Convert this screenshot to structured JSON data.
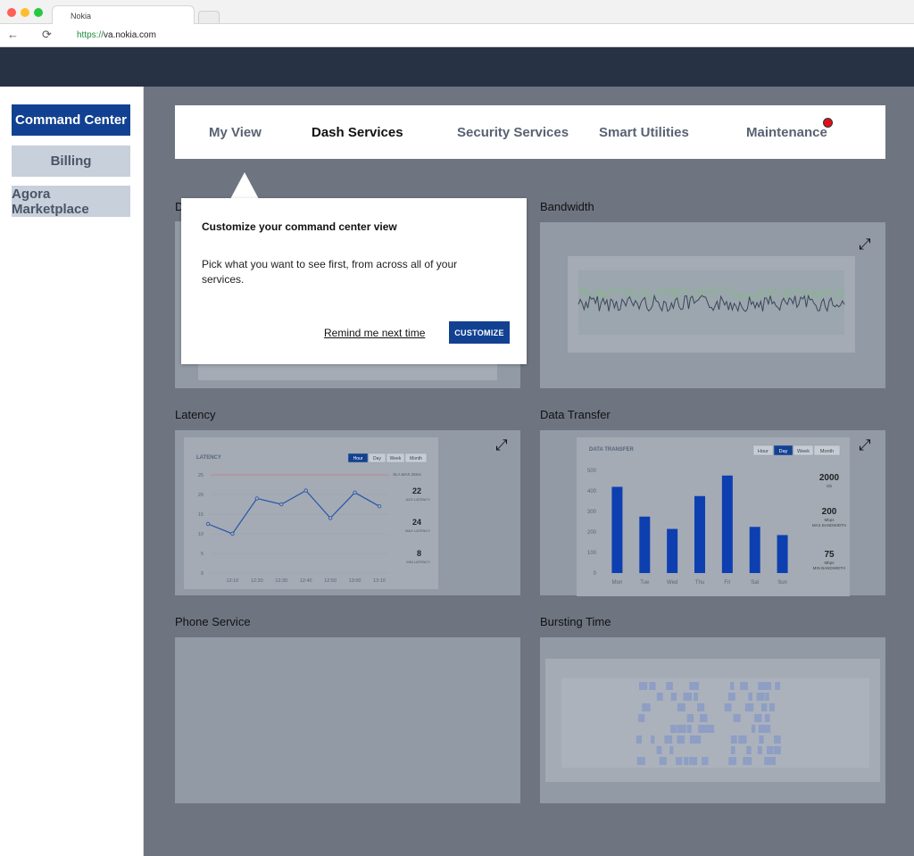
{
  "browser": {
    "tab_title": "Nokia",
    "url_protocol": "https://",
    "url_host": "va.nokia.com",
    "dot_colors": [
      "#fe5f57",
      "#febc2e",
      "#28c840"
    ]
  },
  "sidebar": {
    "items": [
      {
        "label": "Command Center",
        "active": true
      },
      {
        "label": "Billing",
        "active": false
      },
      {
        "label": "Agora Marketplace",
        "active": false
      }
    ]
  },
  "nav": {
    "tabs": [
      {
        "label": "My View"
      },
      {
        "label": "Dash Services"
      },
      {
        "label": "Security Services"
      },
      {
        "label": "Smart Utilities"
      },
      {
        "label": "Maintenance"
      }
    ],
    "notification_color": "#e0101a"
  },
  "panels": {
    "left_top_title_fragment": "D",
    "bandwidth": {
      "title": "Bandwidth"
    },
    "latency": {
      "title": "Latency"
    },
    "data_transfer": {
      "title": "Data Transfer"
    },
    "phone_service": {
      "title": "Phone Service"
    },
    "bursting_time": {
      "title": "Bursting Time"
    }
  },
  "popover": {
    "title": "Customize your command center view",
    "body": "Pick what you want to see first, from across all of your services.",
    "remind_label": "Remind me next time",
    "customize_label": "CUSTOMIZE"
  },
  "colors": {
    "brand_blue": "#124191",
    "header": "#283245",
    "overlay": "#6e7580"
  },
  "chart_data": [
    {
      "type": "line",
      "title": "LATENCY",
      "time_buttons": [
        "Hour",
        "Day",
        "Week",
        "Month"
      ],
      "selected_time": "Hour",
      "x": [
        "",
        "12:10",
        "12:20",
        "12:30",
        "12:40",
        "12:50",
        "13:00",
        "13:10"
      ],
      "series": [
        {
          "values": [
            12.5,
            10,
            19,
            17.5,
            21,
            14,
            20.5,
            17
          ]
        }
      ],
      "ylim": [
        0,
        25
      ],
      "yticks": [
        0,
        5,
        10,
        15,
        20,
        25
      ],
      "threshold_label": "SLA MAX 25ms",
      "stats": [
        {
          "value": "22",
          "label": "AVG LATENCY"
        },
        {
          "value": "24",
          "label": "MAX LATENCY"
        },
        {
          "value": "8",
          "label": "MIN LATENCY"
        }
      ]
    },
    {
      "type": "bar",
      "title": "DATA TRANSFER",
      "time_buttons": [
        "Hour",
        "Day",
        "Week",
        "Month"
      ],
      "selected_time": "Day",
      "categories": [
        "Mon",
        "Tue",
        "Wed",
        "Thu",
        "Fri",
        "Sat",
        "Sun"
      ],
      "values": [
        420,
        275,
        215,
        375,
        475,
        225,
        185
      ],
      "ylim": [
        0,
        500
      ],
      "yticks": [
        0,
        100,
        200,
        300,
        400,
        500
      ],
      "stats": [
        {
          "value": "2000",
          "unit": "Gb",
          "label": ""
        },
        {
          "value": "200",
          "unit": "Mbps",
          "label": "MAX BANDWIDTH"
        },
        {
          "value": "75",
          "unit": "Mbps",
          "label": "MIN BANDWIDTH"
        }
      ]
    }
  ]
}
